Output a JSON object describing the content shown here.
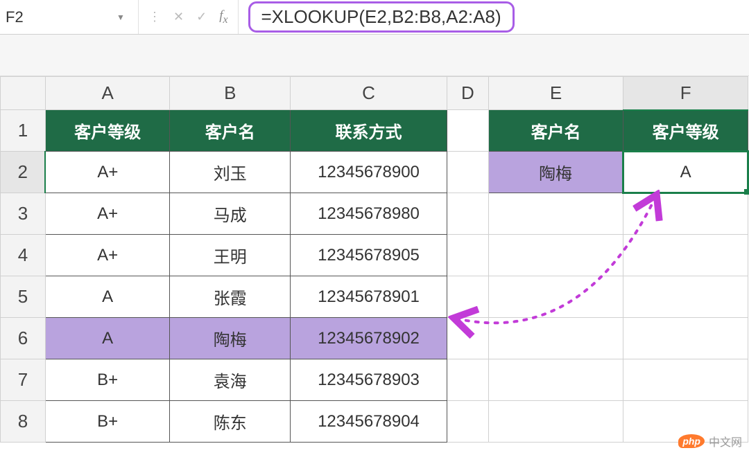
{
  "formula_bar": {
    "cell_ref": "F2",
    "formula": "=XLOOKUP(E2,B2:B8,A2:A8)"
  },
  "columns": [
    "A",
    "B",
    "C",
    "D",
    "E",
    "F"
  ],
  "rows": [
    "1",
    "2",
    "3",
    "4",
    "5",
    "6",
    "7",
    "8"
  ],
  "headers_left": {
    "A": "客户等级",
    "B": "客户名",
    "C": "联系方式"
  },
  "headers_right": {
    "E": "客户名",
    "F": "客户等级"
  },
  "data_rows": [
    {
      "grade": "A+",
      "name": "刘玉",
      "contact": "12345678900"
    },
    {
      "grade": "A+",
      "name": "马成",
      "contact": "12345678980"
    },
    {
      "grade": "A+",
      "name": "王明",
      "contact": "12345678905"
    },
    {
      "grade": "A",
      "name": "张霞",
      "contact": "12345678901"
    },
    {
      "grade": "A",
      "name": "陶梅",
      "contact": "12345678902"
    },
    {
      "grade": "B+",
      "name": "袁海",
      "contact": "12345678903"
    },
    {
      "grade": "B+",
      "name": "陈东",
      "contact": "12345678904"
    }
  ],
  "lookup": {
    "E2": "陶梅",
    "F2": "A"
  },
  "watermark": {
    "logo": "php",
    "text": "中文网"
  },
  "colors": {
    "header_green": "#1f6b46",
    "highlight_purple": "#b9a3de",
    "formula_border": "#a85de6",
    "selection_green": "#1a7f4a"
  }
}
